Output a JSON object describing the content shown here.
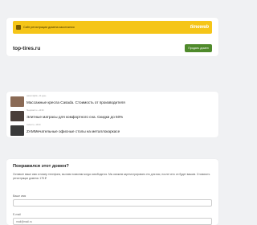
{
  "banner": {
    "text": "Сайт регистрации домена закончился",
    "brand": "timeweb"
  },
  "domain": {
    "name": "top-tires.ru",
    "sell_label": "Продать домен"
  },
  "ads": [
    {
      "meta": "pastel-nights ▪ 14 день",
      "title": "Массажные кресла Casada. Стоимость от производителя",
      "thumb_color": "#8a6a55"
    },
    {
      "meta": "Sleepweb.ru ▪ 14:00",
      "title": "Элитные матрасы для комфортного сна. Скидки до 50%",
      "thumb_color": "#4a3f3a"
    },
    {
      "meta": "mebel.ru ▪ 13:00",
      "title": "ZAMMечательные офисные столы на металлокаркасе",
      "thumb_color": "#3a3a3a"
    }
  ],
  "form": {
    "title": "Понравился этот домен?",
    "description": "Оставьте ваше имя и номер телефона, мы вам позвоним когда освободится. Мы сможем зарегистрировать его для вас, после чего он будет вашим. Стоимость регистрации домена: 175 ₽",
    "name_label": "Ваше имя",
    "email_label": "E-mail",
    "email_placeholder": "mail@mail.ru"
  }
}
